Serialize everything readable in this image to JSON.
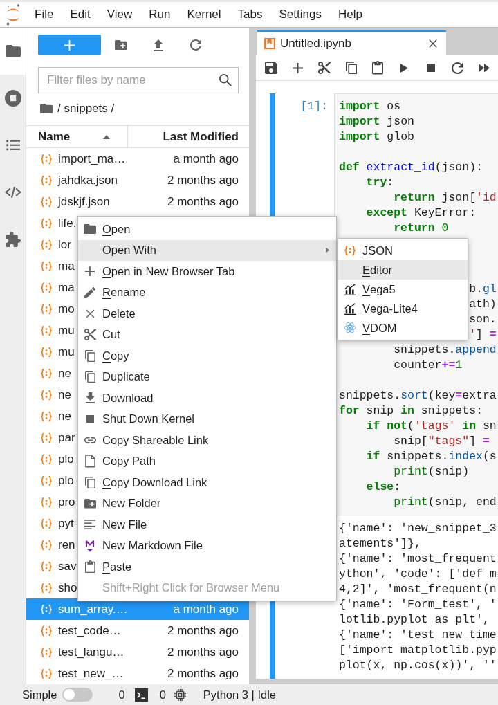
{
  "menu_bar": {
    "items": [
      "File",
      "Edit",
      "View",
      "Run",
      "Kernel",
      "Tabs",
      "Settings",
      "Help"
    ]
  },
  "sidebar": {
    "tabs": [
      {
        "selected": true
      },
      {
        "selected": false
      },
      {
        "selected": false
      },
      {
        "selected": false
      },
      {
        "selected": false
      }
    ]
  },
  "file_browser": {
    "filter": {
      "placeholder": "Filter files by name"
    },
    "path": "/ snippets /",
    "columns": [
      {
        "label": "Name",
        "sorted": true
      },
      {
        "label": "Last Modified",
        "sorted": false
      }
    ],
    "rows": [
      {
        "name": "import_ma…",
        "modified": "a month ago",
        "selected": false
      },
      {
        "name": "jahdka.json",
        "modified": "2 months ago",
        "selected": false
      },
      {
        "name": "jdskjf.json",
        "modified": "2 months ago",
        "selected": false
      },
      {
        "name": "life.",
        "selected": false
      },
      {
        "name": "lor",
        "selected": false
      },
      {
        "name": "ma",
        "selected": false
      },
      {
        "name": "ma",
        "selected": false
      },
      {
        "name": "mo",
        "selected": false
      },
      {
        "name": "mu",
        "selected": false
      },
      {
        "name": "mu",
        "selected": false
      },
      {
        "name": "ne",
        "selected": false
      },
      {
        "name": "ne",
        "selected": false
      },
      {
        "name": "ne",
        "selected": false
      },
      {
        "name": "par",
        "selected": false
      },
      {
        "name": "plo",
        "selected": false
      },
      {
        "name": "plo",
        "selected": false
      },
      {
        "name": "pro",
        "selected": false
      },
      {
        "name": "pyt",
        "selected": false
      },
      {
        "name": "ren",
        "selected": false
      },
      {
        "name": "sav",
        "selected": false
      },
      {
        "name": "sho",
        "selected": false
      },
      {
        "name": "sum_array.…",
        "modified": "a month ago",
        "selected": true
      },
      {
        "name": "test_code…",
        "modified": "2 months ago",
        "selected": false
      },
      {
        "name": "test_langu…",
        "modified": "2 months ago",
        "selected": false
      },
      {
        "name": "test_new_…",
        "modified": "2 months ago",
        "selected": false
      }
    ]
  },
  "notebook": {
    "tabs": [
      {
        "label": "Untitled.ipynb",
        "selected": true
      }
    ],
    "cell": {
      "prompt": "[1]:",
      "lines": [
        {
          "kind": "code",
          "tokens": [
            {
              "kind": "keyword",
              "text": "import"
            },
            {
              "kind": "text",
              "text": " os"
            }
          ]
        },
        {
          "kind": "code",
          "tokens": [
            {
              "kind": "keyword",
              "text": "import"
            },
            {
              "kind": "text",
              "text": " json"
            }
          ]
        },
        {
          "kind": "code",
          "tokens": [
            {
              "kind": "keyword",
              "text": "import"
            },
            {
              "kind": "text",
              "text": " glob"
            }
          ]
        },
        {
          "kind": "empty"
        },
        {
          "kind": "code",
          "tokens": [
            {
              "kind": "keyword",
              "text": "def"
            },
            {
              "kind": "def",
              "text": " extract_id"
            },
            {
              "kind": "text",
              "text": "(json):"
            }
          ]
        },
        {
          "kind": "code",
          "tokens": [
            {
              "kind": "keyword",
              "text": "    try"
            },
            {
              "kind": "text",
              "text": ":"
            }
          ]
        },
        {
          "kind": "code",
          "tokens": [
            {
              "kind": "keyword",
              "text": "        return"
            },
            {
              "kind": "text",
              "text": " json["
            },
            {
              "kind": "string",
              "text": "'id"
            }
          ]
        },
        {
          "kind": "code",
          "tokens": [
            {
              "kind": "keyword",
              "text": "    except"
            },
            {
              "kind": "text",
              "text": " KeyError:"
            }
          ]
        },
        {
          "kind": "code",
          "tokens": [
            {
              "kind": "keyword",
              "text": "        return"
            },
            {
              "kind": "number",
              "text": " 0"
            }
          ]
        },
        {
          "kind": "empty"
        },
        {
          "kind": "empty"
        },
        {
          "kind": "empty"
        },
        {
          "kind": "code",
          "tokens": [
            {
              "kind": "text",
              "text": "                   b."
            },
            {
              "kind": "property",
              "text": "gl"
            }
          ]
        },
        {
          "kind": "code",
          "tokens": [
            {
              "kind": "text",
              "text": "                   ath)"
            }
          ]
        },
        {
          "kind": "code",
          "tokens": [
            {
              "kind": "text",
              "text": "                   son."
            }
          ]
        },
        {
          "kind": "code",
          "tokens": [
            {
              "kind": "string",
              "text": "                   '"
            },
            {
              "kind": "text",
              "text": "] "
            },
            {
              "kind": "operator",
              "text": "="
            }
          ]
        },
        {
          "kind": "code",
          "tokens": [
            {
              "kind": "text",
              "text": "        snippets."
            },
            {
              "kind": "property",
              "text": "append"
            }
          ]
        },
        {
          "kind": "code",
          "tokens": [
            {
              "kind": "text",
              "text": "        counter"
            },
            {
              "kind": "operator",
              "text": "+="
            },
            {
              "kind": "number",
              "text": "1"
            }
          ]
        },
        {
          "kind": "empty"
        },
        {
          "kind": "code",
          "tokens": [
            {
              "kind": "text",
              "text": "snippets."
            },
            {
              "kind": "property",
              "text": "sort"
            },
            {
              "kind": "text",
              "text": "(key"
            },
            {
              "kind": "operator",
              "text": "="
            },
            {
              "kind": "text",
              "text": "extra"
            }
          ]
        },
        {
          "kind": "code",
          "tokens": [
            {
              "kind": "keyword",
              "text": "for"
            },
            {
              "kind": "text",
              "text": " snip "
            },
            {
              "kind": "keyword",
              "text": "in"
            },
            {
              "kind": "text",
              "text": " snippets:"
            }
          ]
        },
        {
          "kind": "code",
          "tokens": [
            {
              "kind": "keyword",
              "text": "    if"
            },
            {
              "kind": "keyword",
              "text": " not"
            },
            {
              "kind": "text",
              "text": "("
            },
            {
              "kind": "string",
              "text": "'tags'"
            },
            {
              "kind": "keyword",
              "text": " in"
            },
            {
              "kind": "text",
              "text": " sn"
            }
          ]
        },
        {
          "kind": "code",
          "tokens": [
            {
              "kind": "text",
              "text": "        snip["
            },
            {
              "kind": "string",
              "text": "\"tags\""
            },
            {
              "kind": "text",
              "text": "] "
            },
            {
              "kind": "operator",
              "text": "="
            }
          ]
        },
        {
          "kind": "code",
          "tokens": [
            {
              "kind": "keyword",
              "text": "    if"
            },
            {
              "kind": "text",
              "text": " snippets."
            },
            {
              "kind": "property",
              "text": "index"
            },
            {
              "kind": "text",
              "text": "(s"
            }
          ]
        },
        {
          "kind": "code",
          "tokens": [
            {
              "kind": "builtin",
              "text": "        print"
            },
            {
              "kind": "text",
              "text": "(snip)"
            }
          ]
        },
        {
          "kind": "code",
          "tokens": [
            {
              "kind": "keyword",
              "text": "    else"
            },
            {
              "kind": "text",
              "text": ":"
            }
          ]
        },
        {
          "kind": "code",
          "tokens": [
            {
              "kind": "builtin",
              "text": "        print"
            },
            {
              "kind": "text",
              "text": "(snip, end"
            }
          ]
        }
      ],
      "output": [
        "{'name': 'new_snippet_3",
        "atements']},",
        "{'name': 'most_frequent",
        "ython', 'code': ['def m",
        "4,2]', 'most_frequent(n",
        "{'name': 'Form_test', '",
        "lotlib.pyplot as plt',",
        "{'name': 'test_new_time",
        "['import matplotlib.pyp",
        "plot(x, np.cos(x))', ''"
      ]
    }
  },
  "context_menu": {
    "items": [
      {
        "label": "Open",
        "kind": "command",
        "mnemonic": true,
        "selected": false,
        "disabled": false
      },
      {
        "label": "Open With",
        "kind": "submenu",
        "mnemonic": false,
        "selected": true,
        "disabled": false
      },
      {
        "label": "Open in New Browser Tab",
        "kind": "command",
        "mnemonic": true,
        "selected": false,
        "disabled": false
      },
      {
        "label": "Rename",
        "kind": "command",
        "mnemonic": true,
        "selected": false,
        "disabled": false
      },
      {
        "label": "Delete",
        "kind": "command",
        "mnemonic": true,
        "selected": false,
        "disabled": false
      },
      {
        "label": "Cut",
        "kind": "command",
        "mnemonic": false,
        "selected": false,
        "disabled": false
      },
      {
        "label": "Copy",
        "kind": "command",
        "mnemonic": true,
        "selected": false,
        "disabled": false
      },
      {
        "label": "Duplicate",
        "kind": "command",
        "mnemonic": false,
        "selected": false,
        "disabled": false
      },
      {
        "label": "Download",
        "kind": "command",
        "mnemonic": false,
        "selected": false,
        "disabled": false
      },
      {
        "label": "Shut Down Kernel",
        "kind": "command",
        "mnemonic": false,
        "selected": false,
        "disabled": false
      },
      {
        "label": "Copy Shareable Link",
        "kind": "command",
        "mnemonic": false,
        "selected": false,
        "disabled": false
      },
      {
        "label": "Copy Path",
        "kind": "command",
        "mnemonic": false,
        "selected": false,
        "disabled": false
      },
      {
        "label": "Copy Download Link",
        "kind": "command",
        "mnemonic": true,
        "selected": false,
        "disabled": false
      },
      {
        "label": "New Folder",
        "kind": "command",
        "mnemonic": false,
        "selected": false,
        "disabled": false
      },
      {
        "label": "New File",
        "kind": "command",
        "mnemonic": false,
        "selected": false,
        "disabled": false
      },
      {
        "label": "New Markdown File",
        "kind": "command",
        "mnemonic": false,
        "selected": false,
        "disabled": false
      },
      {
        "label": "Paste",
        "kind": "command",
        "mnemonic": true,
        "selected": false,
        "disabled": false
      },
      {
        "label": "Shift+Right Click for Browser Menu",
        "kind": "command",
        "mnemonic": false,
        "selected": false,
        "disabled": true
      }
    ]
  },
  "submenu": {
    "items": [
      {
        "label": "JSON",
        "mnemonic": true,
        "selected": false
      },
      {
        "label": "Editor",
        "mnemonic": true,
        "selected": true
      },
      {
        "label": "Vega5",
        "mnemonic": true,
        "selected": false
      },
      {
        "label": "Vega-Lite4",
        "mnemonic": true,
        "selected": false
      },
      {
        "label": "VDOM",
        "mnemonic": true,
        "selected": false
      }
    ]
  },
  "status_bar": {
    "mode_label": "Simple",
    "simple_mode": {
      "on": false
    },
    "terminals": "0",
    "kernels": "0",
    "kernel_status": "Python 3 | Idle"
  }
}
